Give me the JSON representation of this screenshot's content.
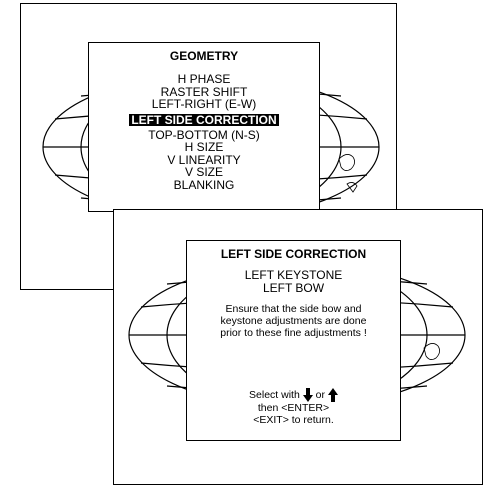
{
  "geometry_menu": {
    "title": "GEOMETRY",
    "items": [
      {
        "label": "H PHASE"
      },
      {
        "label": "RASTER SHIFT"
      },
      {
        "label": "LEFT-RIGHT (E-W)"
      },
      {
        "label": "LEFT SIDE CORRECTION",
        "selected": true
      },
      {
        "label": "TOP-BOTTOM (N-S)"
      },
      {
        "label": "H SIZE"
      },
      {
        "label": "V LINEARITY"
      },
      {
        "label": "V SIZE"
      },
      {
        "label": "BLANKING"
      }
    ]
  },
  "left_side_menu": {
    "title": "LEFT SIDE CORRECTION",
    "items": [
      {
        "label": "LEFT KEYSTONE"
      },
      {
        "label": "LEFT BOW"
      }
    ],
    "note_lines": [
      "Ensure that the side bow and",
      "keystone adjustments are done",
      "prior to these fine adjustments !"
    ],
    "help": {
      "select_with": "Select with",
      "or": "or",
      "then_enter": "then <ENTER>",
      "exit_return": "<EXIT> to return."
    }
  },
  "icons": {
    "down": "arrow-down-icon",
    "up": "arrow-up-icon"
  }
}
